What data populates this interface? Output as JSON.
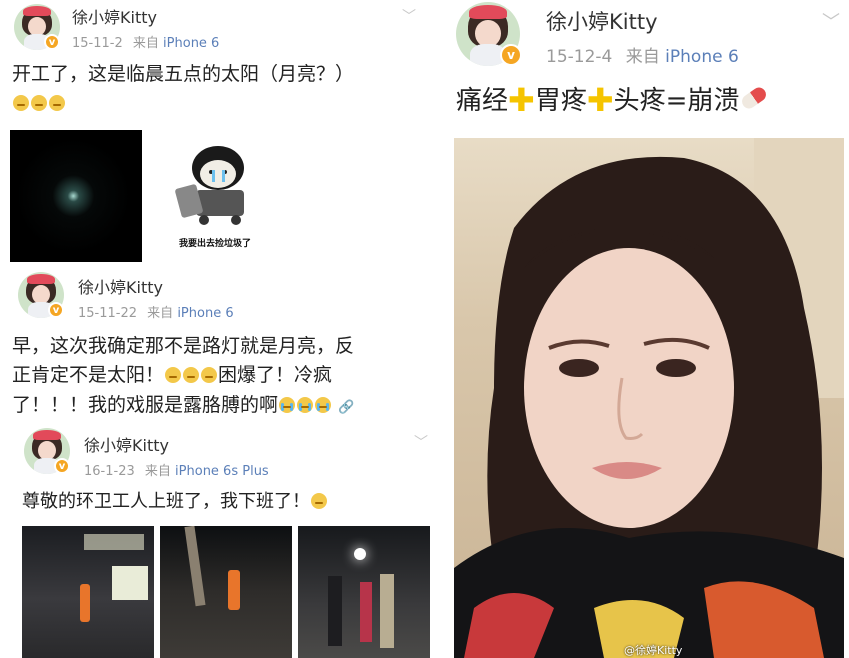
{
  "posts": [
    {
      "user": "徐小婷Kitty",
      "date": "15-11-2",
      "via": "来自",
      "source": "iPhone 6",
      "text": "开工了，这是临晨五点的太阳（月亮？）",
      "meme_caption": "我要出去捡垃圾了"
    },
    {
      "user": "徐小婷Kitty",
      "date": "15-11-22",
      "via": "来自",
      "source": "iPhone 6",
      "text_line1": "早，这次我确定那不是路灯就是月亮，反",
      "text_line2a": "正肯定不是太阳！",
      "text_line2b": "困爆了！冷疯",
      "text_line3": "了！！！我的戏服是露胳膊的啊"
    },
    {
      "user": "徐小婷Kitty",
      "date": "16-1-23",
      "via": "来自",
      "source": "iPhone 6s Plus",
      "text": "尊敬的环卫工人上班了，我下班了！"
    },
    {
      "user": "徐小婷Kitty",
      "date": "15-12-4",
      "via": "来自",
      "source": "iPhone 6",
      "text_part1": "痛经",
      "text_part2": "胃疼",
      "text_part3": "头疼=崩溃",
      "watermark": "@徐婷Kitty"
    }
  ],
  "icons": [
    "verified-icon",
    "chevron-down-icon",
    "link-icon",
    "emoji-sad-icon",
    "emoji-cry-icon",
    "plus-icon",
    "pill-icon"
  ],
  "colors": {
    "source_link": "#5b7fb8",
    "meta": "#9a9a9a",
    "badge": "#f5a623",
    "plus": "#f5c400"
  }
}
